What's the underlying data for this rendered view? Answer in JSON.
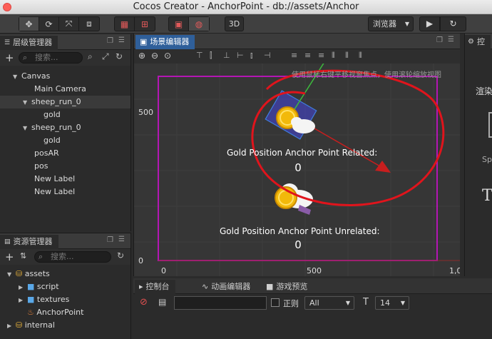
{
  "window": {
    "title": "Cocos Creator - AnchorPoint - db://assets/Anchor"
  },
  "toolbar": {
    "preview_label": "浏览器",
    "mode_3d_label": "3D",
    "tools": [
      "move-tool",
      "rotate-tool",
      "scale-tool",
      "rect-tool"
    ]
  },
  "hierarchy": {
    "title": "层级管理器",
    "search_placeholder": "搜索...",
    "nodes": [
      {
        "label": "Canvas",
        "expanded": true
      },
      {
        "label": "Main Camera"
      },
      {
        "label": "sheep_run_0",
        "expanded": true,
        "selected": true
      },
      {
        "label": "gold"
      },
      {
        "label": "sheep_run_0",
        "expanded": true
      },
      {
        "label": "gold"
      },
      {
        "label": "posAR"
      },
      {
        "label": "pos"
      },
      {
        "label": "New Label"
      },
      {
        "label": "New Label"
      }
    ]
  },
  "assets": {
    "title": "资源管理器",
    "search_placeholder": "搜索...",
    "items": [
      {
        "label": "assets",
        "kind": "db"
      },
      {
        "label": "script",
        "kind": "folder"
      },
      {
        "label": "textures",
        "kind": "folder"
      },
      {
        "label": "AnchorPoint",
        "kind": "scene"
      },
      {
        "label": "internal",
        "kind": "db"
      }
    ]
  },
  "scene": {
    "title": "场景编辑器",
    "hint": "使用鼠标右键平移视窗焦点，使用滚轮缩放视图",
    "ruler": {
      "y_500": "500",
      "y_0": "0",
      "x_0": "0",
      "x_500": "500",
      "x_1000": "1,0"
    },
    "label1_title": "Gold Position Anchor Point Related:",
    "label1_value": "0",
    "label2_title": "Gold Position Anchor Point Unrelated:",
    "label2_value": "0"
  },
  "console": {
    "tabs": [
      "控制台",
      "动画编辑器",
      "游戏预览"
    ],
    "regex_label": "正则",
    "filter_value": "All",
    "font_size": "14"
  },
  "inspector": {
    "title": "控",
    "partial_text_1": "渲染",
    "partial_text_2": "Sp",
    "partial_text_3": "T"
  }
}
